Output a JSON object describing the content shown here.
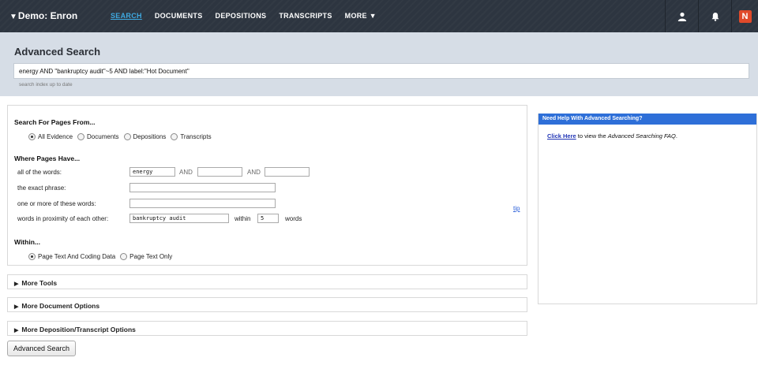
{
  "topbar": {
    "project": "Demo: Enron",
    "project_caret": "▼",
    "nav": [
      {
        "label": "SEARCH",
        "active": true
      },
      {
        "label": "DOCUMENTS"
      },
      {
        "label": "DEPOSITIONS"
      },
      {
        "label": "TRANSCRIPTS"
      },
      {
        "label": "MORE ▼"
      }
    ],
    "icons": [
      "user-icon",
      "bell-icon",
      "app-logo-icon"
    ],
    "logo_glyph": "N"
  },
  "header": {
    "title": "Advanced Search",
    "query": "energy AND \"bankruptcy audit\"~5 AND label:\"Hot Document\"",
    "index_status": "search index up to date"
  },
  "search_from": {
    "title": "Search For Pages From...",
    "options": [
      {
        "label": "All Evidence",
        "checked": true
      },
      {
        "label": "Documents",
        "checked": false
      },
      {
        "label": "Depositions",
        "checked": false
      },
      {
        "label": "Transcripts",
        "checked": false
      }
    ]
  },
  "where": {
    "title": "Where Pages Have...",
    "all_words_label": "all of the words:",
    "all_words_values": [
      "energy",
      "",
      ""
    ],
    "and_label": "AND",
    "exact_phrase_label": "the exact phrase:",
    "exact_phrase_value": "",
    "one_or_more_label": "one or more of these words:",
    "one_or_more_value": "",
    "proximity_label": "words in proximity of each other:",
    "proximity_value": "bankruptcy audit",
    "within_label": "within",
    "within_value": "5",
    "words_label": "words",
    "tip_label": "tip"
  },
  "within": {
    "title": "Within...",
    "options": [
      {
        "label": "Page Text And Coding Data",
        "checked": true
      },
      {
        "label": "Page Text Only",
        "checked": false
      }
    ]
  },
  "collapsibles": [
    {
      "label": "More Tools"
    },
    {
      "label": "More Document Options"
    },
    {
      "label": "More Deposition/Transcript Options"
    }
  ],
  "collapse_glyph": "▶",
  "submit_label": "Advanced Search",
  "help": {
    "title": "Need Help With Advanced Searching?",
    "link_label": "Click Here",
    "text_pre": " to view the ",
    "text_em": "Advanced Searching FAQ",
    "text_post": "."
  }
}
